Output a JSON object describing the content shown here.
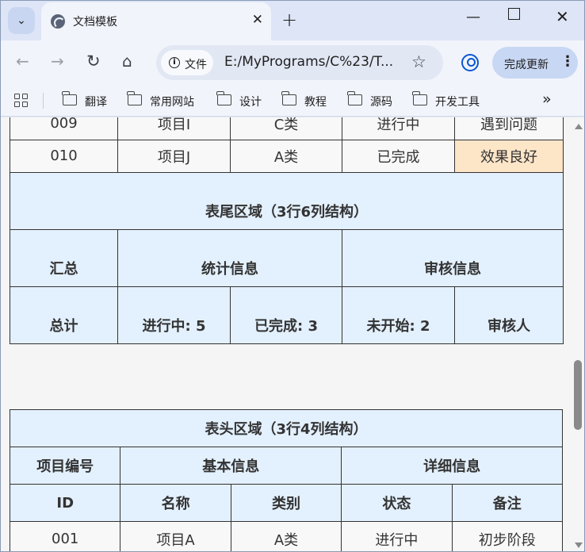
{
  "browser": {
    "tab_title": "文档模板",
    "url_chip": "文件",
    "url": "E:/MyPrograms/C%23/T...",
    "update_button": "完成更新",
    "bookmarks": [
      "翻译",
      "常用网站",
      "设计",
      "教程",
      "源码",
      "开发工具"
    ]
  },
  "table1": {
    "rows": [
      [
        "009",
        "项目I",
        "C类",
        "进行中",
        "遇到问题"
      ],
      [
        "010",
        "项目J",
        "A类",
        "已完成",
        "效果良好"
      ]
    ],
    "footer_title": "表尾区域（3行6列结构）",
    "footer_row1": [
      "汇总",
      "统计信息",
      "审核信息"
    ],
    "footer_row2": [
      "总计",
      "进行中: 5",
      "已完成: 3",
      "未开始: 2",
      "审核人"
    ]
  },
  "table2": {
    "header_title": "表头区域（3行4列结构）",
    "header_row1": [
      "项目编号",
      "基本信息",
      "详细信息"
    ],
    "header_row2": [
      "ID",
      "名称",
      "类别",
      "状态",
      "备注"
    ],
    "rows": [
      [
        "001",
        "项目A",
        "A类",
        "进行中",
        "初步阶段"
      ]
    ]
  },
  "colors": {
    "header_blue": "#e3f0fd",
    "highlight_orange": "#fde5c8"
  }
}
